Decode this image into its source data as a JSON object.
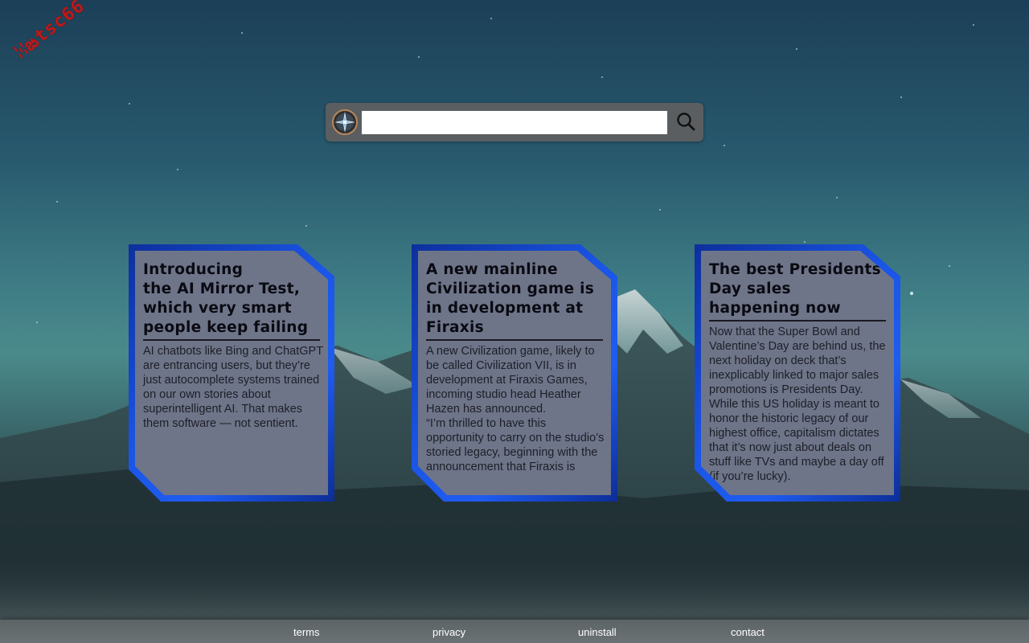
{
  "logo": {
    "text": "ꔘఙtsc66"
  },
  "search": {
    "value": "",
    "placeholder": ""
  },
  "icons": {
    "compass": "compass-icon",
    "search": "search-icon"
  },
  "colors": {
    "card_border": "#1a55e6",
    "card_face": "#6e7589",
    "search_bar": "#5b5e60",
    "footer": "#646b6d"
  },
  "cards": [
    {
      "title": "Introducing\nthe AI Mirror Test, which very smart people keep failing",
      "body": "AI chatbots like Bing and ChatGPT are entrancing users, but they’re just autocomplete systems trained on our own stories about superintelligent AI. That makes them software — not sentient."
    },
    {
      "title": "A new mainline Civilization game is in development at Firaxis",
      "body": "A new Civilization game, likely to be called Civilization VII, is in development at Firaxis Games, incoming studio head Heather Hazen has announced.\n“I’m thrilled to have this opportunity to carry on the studio’s storied legacy, beginning with the announcement that Firaxis is"
    },
    {
      "title": "The best Presidents Day sales happening now",
      "body": "Now that the Super Bowl and Valentine’s Day are behind us, the next holiday on deck that’s inexplicably linked to major sales promotions is Presidents Day. While this US holiday is meant to honor the historic legacy of our highest office, capitalism dictates that it’s now just about deals on stuff like TVs and maybe a day off (if you’re lucky)."
    }
  ],
  "footer": {
    "terms": "terms",
    "privacy": "privacy",
    "uninstall": "uninstall",
    "contact": "contact"
  }
}
